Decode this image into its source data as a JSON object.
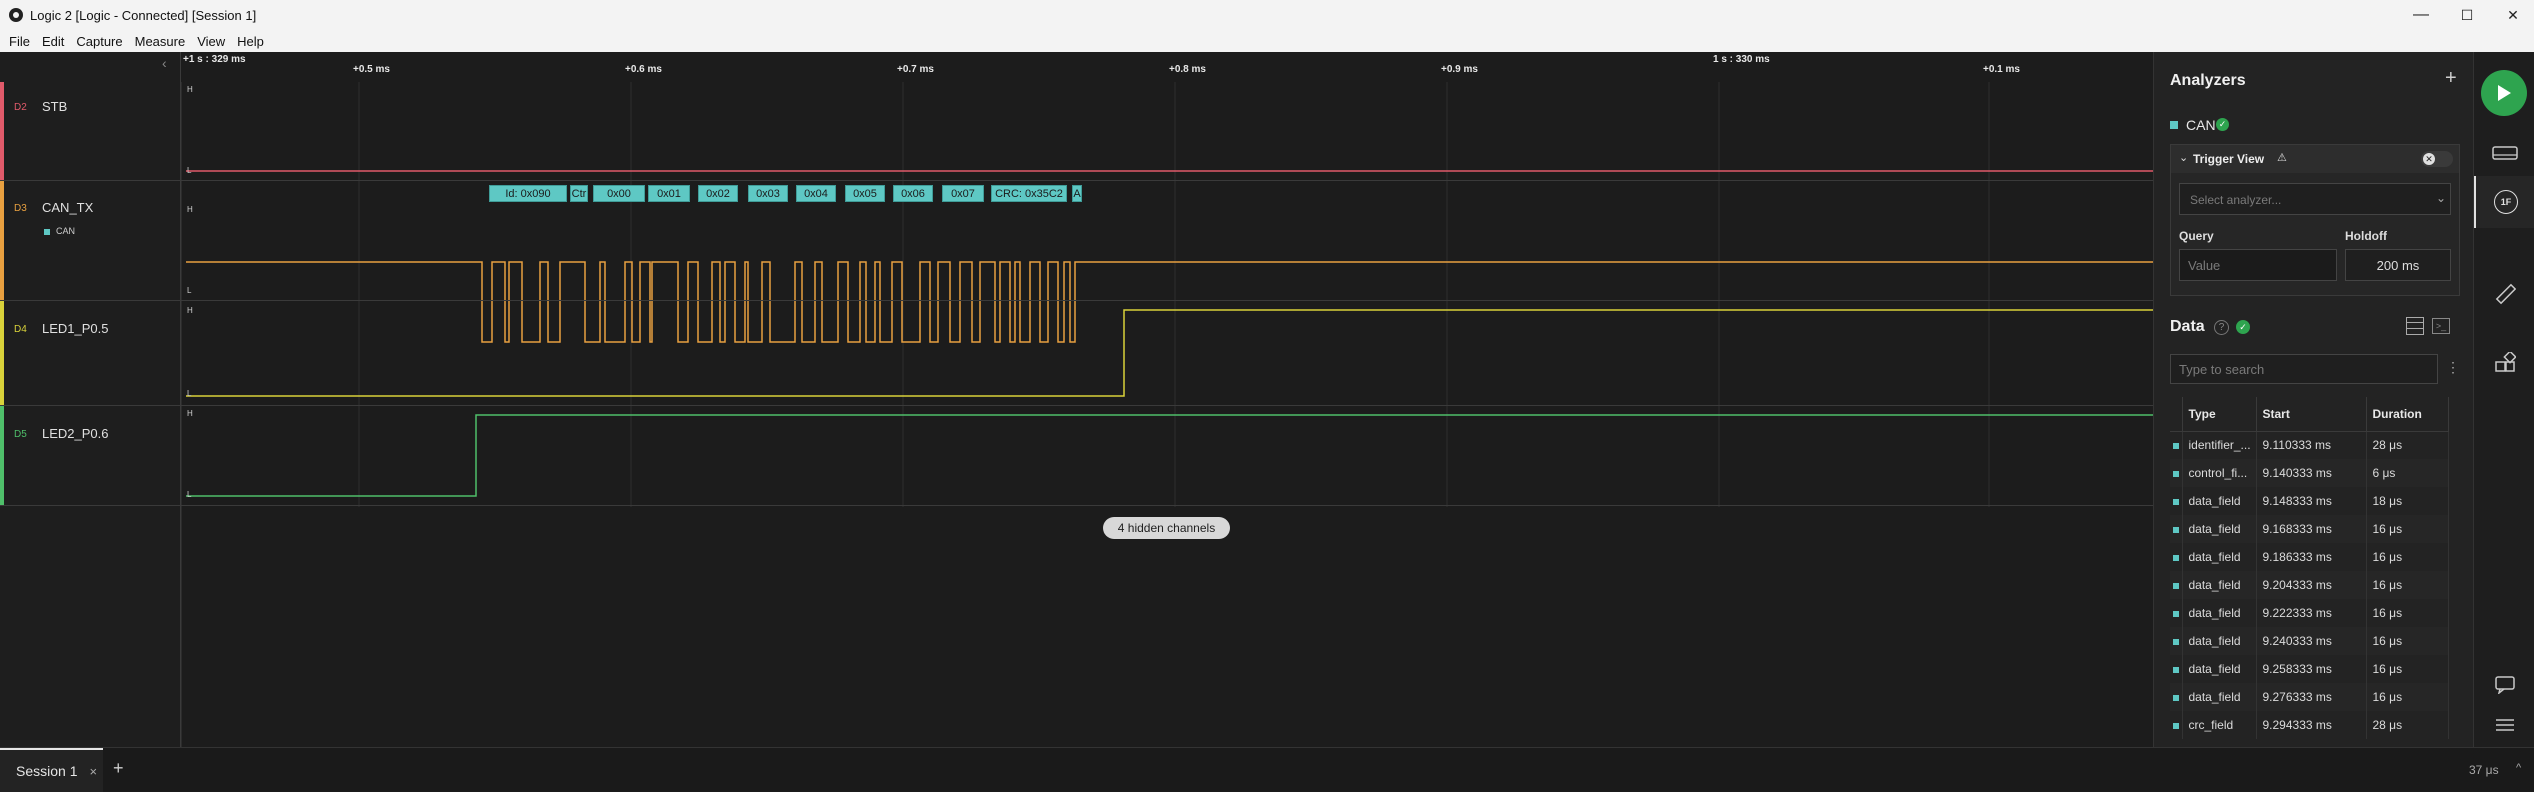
{
  "window": {
    "title": "Logic 2 [Logic - Connected] [Session 1]",
    "minimize": "—",
    "maximize": "☐",
    "close": "✕"
  },
  "menu": [
    "File",
    "Edit",
    "Capture",
    "Measure",
    "View",
    "Help"
  ],
  "ruler": {
    "origin_label": "+1 s : 329 ms",
    "mid_label": "1 s : 330 ms",
    "ticks": [
      "+0.5 ms",
      "+0.6 ms",
      "+0.7 ms",
      "+0.8 ms",
      "+0.9 ms",
      "+0.1 ms"
    ]
  },
  "channels": [
    {
      "id": "D2",
      "name": "STB",
      "color": "#e05a6a",
      "high": "H",
      "low": "L"
    },
    {
      "id": "D3",
      "name": "CAN_TX",
      "color": "#e8a040",
      "high": "H",
      "low": "L",
      "analyzer_tag": "CAN"
    },
    {
      "id": "D4",
      "name": "LED1_P0.5",
      "color": "#d9d23a",
      "high": "H",
      "low": "L"
    },
    {
      "id": "D5",
      "name": "LED2_P0.6",
      "color": "#4fbf6a",
      "high": "H",
      "low": "L"
    }
  ],
  "decode_frames": [
    "Id: 0x090",
    "Ctr",
    "0x00",
    "0x01",
    "0x02",
    "0x03",
    "0x04",
    "0x05",
    "0x06",
    "0x07",
    "CRC: 0x35C2",
    "A"
  ],
  "hidden_channels": "4 hidden channels",
  "analyzers": {
    "heading": "Analyzers",
    "add": "+",
    "items": [
      {
        "name": "CAN",
        "color": "#5ec8c4"
      }
    ],
    "trigger": {
      "title": "Trigger View",
      "select_placeholder": "Select analyzer...",
      "query_label": "Query",
      "query_placeholder": "Value",
      "holdoff_label": "Holdoff",
      "holdoff_value": "200 ms"
    }
  },
  "data": {
    "heading": "Data",
    "search_placeholder": "Type to search",
    "columns": [
      "Type",
      "Start",
      "Duration"
    ],
    "rows": [
      [
        "identifier_...",
        "9.110333 ms",
        "28 μs"
      ],
      [
        "control_fi...",
        "9.140333 ms",
        "6 μs"
      ],
      [
        "data_field",
        "9.148333 ms",
        "18 μs"
      ],
      [
        "data_field",
        "9.168333 ms",
        "16 μs"
      ],
      [
        "data_field",
        "9.186333 ms",
        "16 μs"
      ],
      [
        "data_field",
        "9.204333 ms",
        "16 μs"
      ],
      [
        "data_field",
        "9.222333 ms",
        "16 μs"
      ],
      [
        "data_field",
        "9.240333 ms",
        "16 μs"
      ],
      [
        "data_field",
        "9.258333 ms",
        "16 μs"
      ],
      [
        "data_field",
        "9.276333 ms",
        "16 μs"
      ],
      [
        "crc_field",
        "9.294333 ms",
        "28 μs"
      ]
    ]
  },
  "session": {
    "tab": "Session 1",
    "close": "×",
    "add": "+"
  },
  "status": {
    "duration": "37 μs"
  },
  "colors": {
    "accent_green": "#2ea44f",
    "can_teal": "#5ec8c4"
  }
}
